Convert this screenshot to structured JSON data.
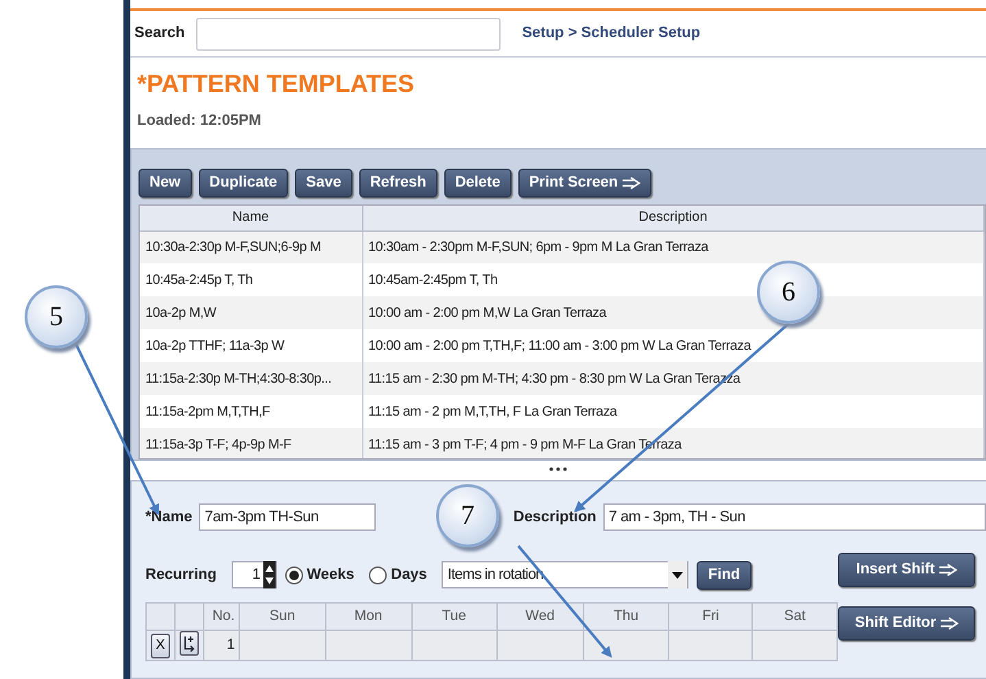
{
  "search": {
    "label": "Search"
  },
  "breadcrumb": "Setup > Scheduler Setup",
  "title": "*PATTERN TEMPLATES",
  "loaded": "Loaded: 12:05PM",
  "toolbar": [
    {
      "label": "New",
      "arrow": false
    },
    {
      "label": "Duplicate",
      "arrow": false
    },
    {
      "label": "Save",
      "arrow": false
    },
    {
      "label": "Refresh",
      "arrow": false
    },
    {
      "label": "Delete",
      "arrow": false
    },
    {
      "label": "Print Screen",
      "arrow": true
    }
  ],
  "table": {
    "columns": [
      "Name",
      "Description"
    ],
    "rows": [
      [
        "10:30a-2:30p M-F,SUN;6-9p M",
        "10:30am - 2:30pm M-F,SUN; 6pm - 9pm M La Gran Terraza"
      ],
      [
        "10:45a-2:45p T, Th",
        "10:45am-2:45pm T, Th"
      ],
      [
        "10a-2p M,W",
        "10:00 am - 2:00 pm M,W La Gran Terraza"
      ],
      [
        "10a-2p TTHF; 11a-3p W",
        "10:00 am - 2:00 pm T,TH,F; 11:00 am - 3:00 pm W La Gran Terraza"
      ],
      [
        "11:15a-2:30p M-TH;4:30-8:30p...",
        "11:15 am - 2:30 pm M-TH; 4:30 pm - 8:30 pm W La Gran Terazza"
      ],
      [
        "11:15a-2pm M,T,TH,F",
        "11:15 am - 2 pm M,T,TH, F La Gran Terraza"
      ],
      [
        "11:15a-3p T-F; 4p-9p M-F",
        "11:15 am - 3 pm T-F; 4 pm - 9 pm M-F La Gran Terraza"
      ]
    ]
  },
  "form": {
    "name": {
      "label": "*Name",
      "value": "7am-3pm TH-Sun"
    },
    "description": {
      "label": "Description",
      "value": "7 am - 3pm, TH - Sun"
    },
    "recurring": {
      "label": "Recurring",
      "value": "1"
    },
    "units": [
      {
        "label": "Weeks",
        "selected": true
      },
      {
        "label": "Days",
        "selected": false
      }
    ],
    "rotation": {
      "value": "Items in rotation"
    },
    "find": "Find",
    "side_buttons": [
      "Insert Shift",
      "Shift Editor"
    ]
  },
  "grid": {
    "columns": [
      "No.",
      "Sun",
      "Mon",
      "Tue",
      "Wed",
      "Thu",
      "Fri",
      "Sat"
    ],
    "rows": [
      {
        "delete": "X",
        "no": "1"
      }
    ]
  },
  "callouts": [
    "5",
    "6",
    "7"
  ]
}
